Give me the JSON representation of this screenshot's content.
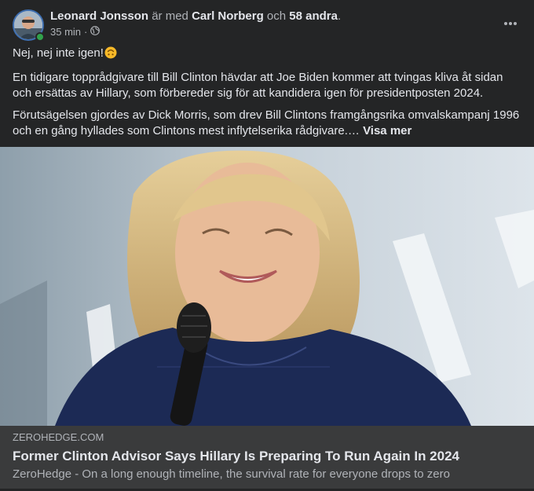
{
  "header": {
    "author": "Leonard Jonsson",
    "with_text": "är med",
    "tagged": "Carl Norberg",
    "and_text": "och",
    "others": "58 andra",
    "period": ".",
    "time": "35 min",
    "separator": "·",
    "privacy_icon": "globe-icon",
    "more_icon": "more-dots-icon"
  },
  "post": {
    "line1": "Nej, nej inte igen!",
    "emoji": "upside-down-face",
    "para1": "En tidigare topprådgivare till Bill Clinton hävdar att Joe Biden kommer att tvingas kliva åt sidan och ersättas av Hillary, som förbereder sig för att kandidera igen för presidentposten 2024.",
    "para2": "Förutsägelsen gjordes av Dick Morris, som drev Bill Clintons framgångsrika omvalskampanj 1996 och en gång hyllades som Clintons mest inflytelserika rådgivare.…",
    "see_more": "Visa mer"
  },
  "link": {
    "domain": "ZEROHEDGE.COM",
    "title": "Former Clinton Advisor Says Hillary Is Preparing To Run Again In 2024",
    "description": "ZeroHedge - On a long enough timeline, the survival rate for everyone drops to zero"
  },
  "colors": {
    "card_bg": "#242526",
    "link_bg": "#3a3b3c",
    "primary_text": "#e4e6eb",
    "secondary_text": "#b0b3b8",
    "online": "#31a24c"
  }
}
